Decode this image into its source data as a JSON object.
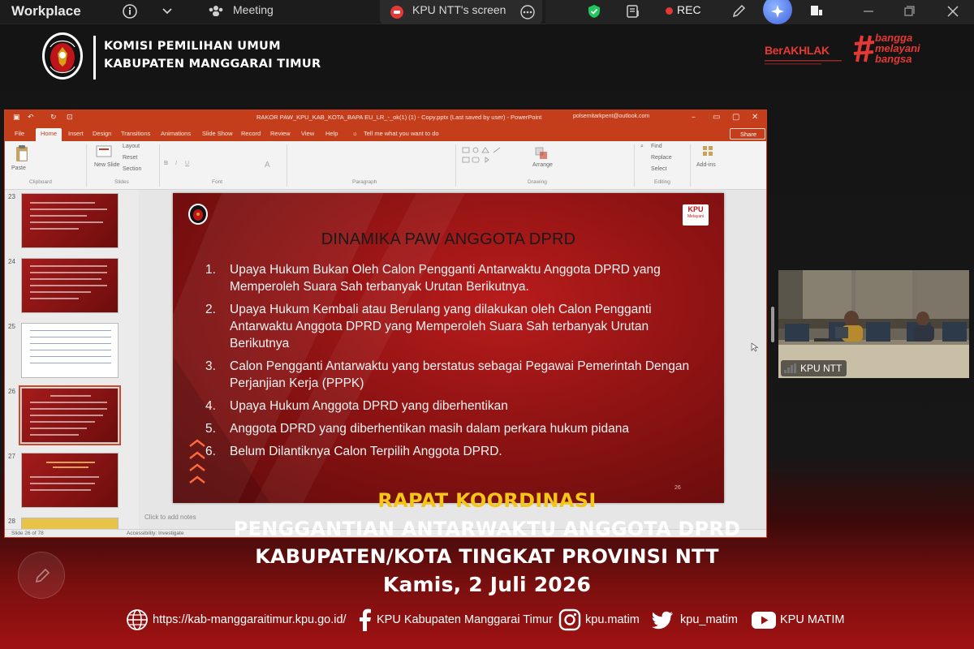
{
  "zoom": {
    "app_title": "Workplace",
    "meeting_label": "Meeting",
    "share_tab_label": "KPU NTT's screen",
    "rec_label": "REC"
  },
  "header": {
    "org_line1": "KOMISI PEMILIHAN UMUM",
    "org_line2": "KABUPATEN MANGGARAI TIMUR",
    "berakhlak": "BerAKHLAK",
    "bangga": [
      "bangga",
      "melayani",
      "bangsa"
    ]
  },
  "ppt": {
    "window_title": "RAKOR PAW_KPU_KAB_KOTA_BAPA EU_LR_-_ok(1) (1) - Copy.pptx (Last saved by user) - PowerPoint",
    "account": "polsemitarkpent@outlook.com",
    "menus": [
      "File",
      "Home",
      "Insert",
      "Design",
      "Transitions",
      "Animations",
      "Slide Show",
      "Record",
      "Review",
      "View",
      "Help"
    ],
    "tell_me": "Tell me what you want to do",
    "share_label": "Share",
    "ribbon": {
      "paste": "Paste",
      "new_slide": "New Slide",
      "layout": "Layout",
      "reset": "Reset",
      "section": "Section",
      "find": "Find",
      "replace": "Replace",
      "select": "Select",
      "arrange": "Arrange",
      "add_ins": "Add-ins",
      "groups": [
        "Clipboard",
        "Slides",
        "Font",
        "Paragraph",
        "Drawing",
        "Editing"
      ]
    },
    "thumbnails": [
      {
        "num": "23"
      },
      {
        "num": "24"
      },
      {
        "num": "25"
      },
      {
        "num": "26"
      },
      {
        "num": "27"
      },
      {
        "num": "28"
      }
    ],
    "notes_hint": "Click to add notes",
    "status": {
      "slide": "Slide 26 of 78",
      "accessibility": "Accessibility: Investigate"
    }
  },
  "slide": {
    "badge_line1": "KPU",
    "badge_line2": "Melayani",
    "title": "DINAMIKA PAW ANGGOTA DPRD",
    "items": [
      {
        "num": "1.",
        "text": "Upaya Hukum Bukan Oleh Calon Pengganti Antarwaktu Anggota DPRD yang Memperoleh Suara Sah terbanyak Urutan Berikutnya."
      },
      {
        "num": "2.",
        "text": "Upaya Hukum Kembali atau Berulang yang dilakukan oleh Calon Pengganti Antarwaktu Anggota DPRD yang Memperoleh Suara Sah terbanyak Urutan Berikutnya"
      },
      {
        "num": "3.",
        "text": "Calon Pengganti Antarwaktu yang berstatus sebagai Pegawai Pemerintah Dengan Perjanjian Kerja (PPPK)"
      },
      {
        "num": "4.",
        "text": "Upaya Hukum Anggota DPRD yang diberhentikan"
      },
      {
        "num": "5.",
        "text": "Anggota DPRD yang diberhentikan masih dalam perkara hukum pidana"
      },
      {
        "num": "6.",
        "text": "Belum Dilantiknya Calon Terpilih Anggota DPRD."
      }
    ],
    "page_num": "26"
  },
  "participant": {
    "name": "KPU NTT"
  },
  "caption": {
    "line1": "RAPAT KOORDINASI",
    "line2": "PENGGANTIAN ANTARWAKTU ANGGOTA DPRD",
    "line3": "KABUPATEN/KOTA TINGKAT PROVINSI NTT",
    "line4": "Kamis, 2 Juli 2026"
  },
  "social": {
    "website": "https://kab-manggaraitimur.kpu.go.id/",
    "facebook": "KPU Kabupaten Manggarai Timur",
    "instagram": "kpu.matim",
    "twitter": "kpu_matim",
    "youtube": "KPU MATIM"
  },
  "colors": {
    "caption_accent": "#f5c518",
    "ppt_accent": "#c43e1c",
    "slide_red": "#8f1313",
    "brand_red": "#e53935"
  }
}
